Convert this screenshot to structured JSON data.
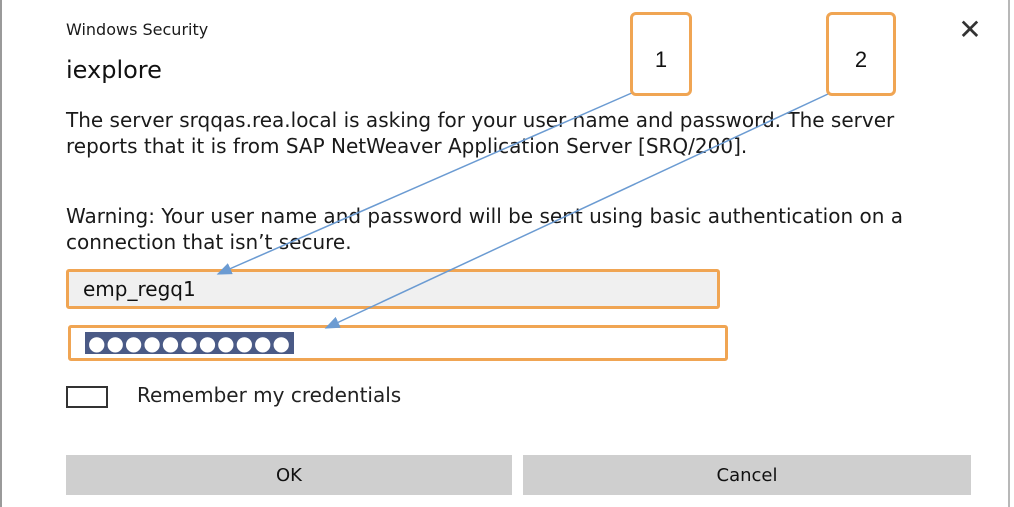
{
  "window": {
    "app_title": "Windows Security",
    "close_glyph": "✕",
    "heading": "iexplore"
  },
  "message": {
    "server_text": "The server srqqas.rea.local is asking for your user name and password. The server reports that it is from SAP NetWeaver Application Server [SRQ/200].",
    "warning_text": "Warning: Your user name and password will be sent using basic authentication on a connection that isn’t secure."
  },
  "credentials": {
    "username_value": "emp_regq1",
    "password_mask": "●●●●●●●●●●●",
    "remember_label": "Remember my credentials",
    "remember_checked": false
  },
  "buttons": {
    "ok_label": "OK",
    "cancel_label": "Cancel"
  },
  "annotations": {
    "callout_1": "1",
    "callout_2": "2",
    "highlight_color": "#f0a553",
    "arrow_color": "#6b9bd2"
  },
  "icons": {
    "close": "close-icon",
    "checkbox": "checkbox-icon"
  }
}
